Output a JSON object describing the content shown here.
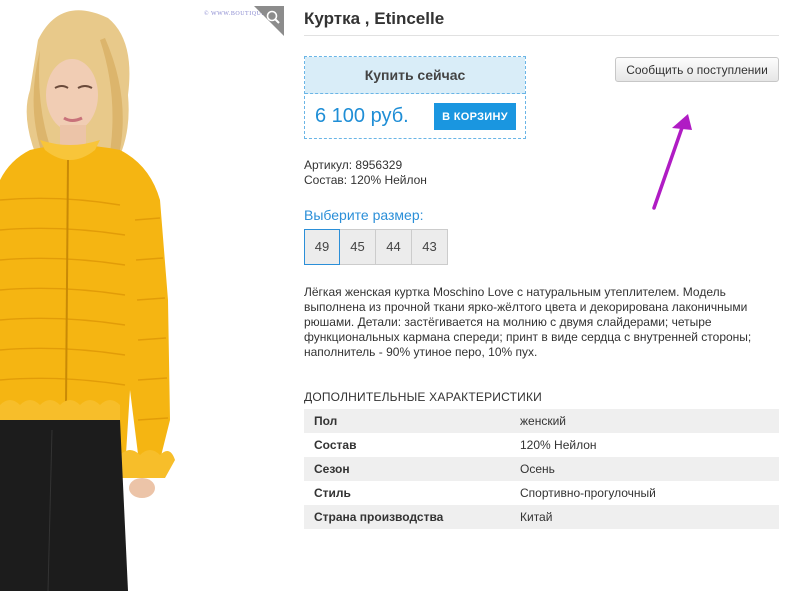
{
  "product": {
    "title": "Куртка , Etincelle",
    "watermark": "© WWW.BOUTIQUE",
    "buy_now": "Купить сейчас",
    "price": "6 100 руб.",
    "add_to_cart": "В КОРЗИНУ",
    "notify": "Сообщить о поступлении",
    "article": "Артикул: 8956329",
    "composition": "Состав: 120% Нейлон",
    "choose_size": "Выберите размер:",
    "sizes": [
      "49",
      "45",
      "44",
      "43"
    ],
    "selected_size": "49",
    "description": "Лёгкая женская куртка Moschino Love с натуральным утеплителем. Модель выполнена из прочной ткани ярко-жёлтого цвета и декорирована лаконичными рюшами. Детали: застёгивается на молнию с двумя слайдерами; четыре функциональных кармана спереди; принт в виде сердца с внутренней стороны; наполнитель - 90% утиное перо, 10% пух."
  },
  "specs": {
    "title": "ДОПОЛНИТЕЛЬНЫЕ ХАРАКТЕРИСТИКИ",
    "rows": [
      {
        "key": "Пол",
        "value": "женский"
      },
      {
        "key": "Состав",
        "value": "120% Нейлон"
      },
      {
        "key": "Сезон",
        "value": "Осень"
      },
      {
        "key": "Стиль",
        "value": "Спортивно-прогулочный"
      },
      {
        "key": "Страна производства",
        "value": "Китай"
      }
    ]
  },
  "colors": {
    "accent": "#1a96e0",
    "buy_box_bg": "#d9edf8",
    "jacket": "#f5b512",
    "annotation_arrow": "#b01cc4"
  },
  "icons": {
    "zoom": "magnifier-icon",
    "arrow": "annotation-arrow-icon"
  }
}
